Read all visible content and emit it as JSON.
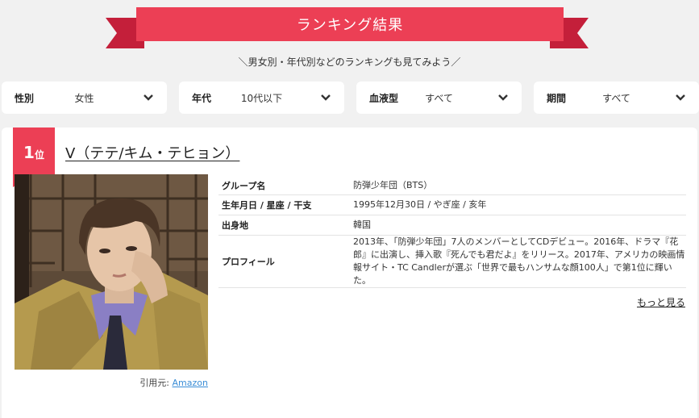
{
  "banner": {
    "title": "ランキング結果"
  },
  "subtitle": "＼男女別・年代別などのランキングも見てみよう／",
  "filters": [
    {
      "label": "性別",
      "value": "女性"
    },
    {
      "label": "年代",
      "value": "10代以下"
    },
    {
      "label": "血液型",
      "value": "すべて"
    },
    {
      "label": "期間",
      "value": "すべて"
    }
  ],
  "result": {
    "rank_number": "1",
    "rank_suffix": "位",
    "name": "V（テテ/キム・テヒョン）",
    "info": [
      {
        "key": "グループ名",
        "value": "防弾少年団（BTS）"
      },
      {
        "key": "生年月日 / 星座 / 干支",
        "value": "1995年12月30日 / やぎ座 / 亥年"
      },
      {
        "key": "出身地",
        "value": "韓国"
      },
      {
        "key": "プロフィール",
        "value": "2013年、「防弾少年団」7人のメンバーとしてCDデビュー。2016年、ドラマ『花郎』に出演し、挿入歌『死んでも君だよ』をリリース。2017年、アメリカの映画情報サイト・TC Candlerが選ぶ「世界で最もハンサムな顔100人」で第1位に輝いた。"
      }
    ],
    "more_label": "もっと見る",
    "source_label": "引用元:",
    "source_link": "Amazon"
  },
  "colors": {
    "accent": "#ec3f55",
    "ribbon_dark": "#c41f3a",
    "link": "#3a8dd6"
  }
}
